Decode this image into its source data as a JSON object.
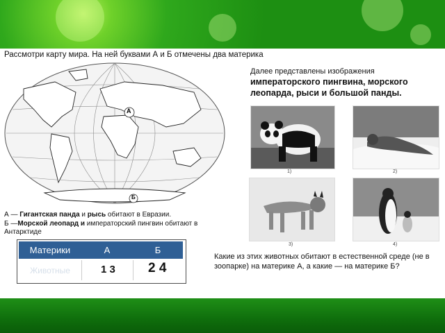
{
  "task": {
    "line1": "Рассмотри карту мира. На ней буквами А и Б отмечены два материка"
  },
  "map": {
    "label_a": "А",
    "label_b": "Б"
  },
  "intro": {
    "lead": "Далее представлены изображения",
    "bold": "императорского пингвина, морского леопарда, рыси и большой панды."
  },
  "photos": [
    {
      "caption": "1)",
      "icon": "panda"
    },
    {
      "caption": "2)",
      "icon": "leopard-seal"
    },
    {
      "caption": "3)",
      "icon": "lynx"
    },
    {
      "caption": "4)",
      "icon": "penguin"
    }
  ],
  "note": {
    "a_prefix": "А — ",
    "a_bold1": "Гигантская панда",
    "a_and": " и ",
    "a_bold2": "рысь",
    "a_rest": " обитают в Евразии.",
    "b_prefix": "Б —",
    "b_bold1": "Морской леопард",
    "b_and": " и ",
    "b_rest": "императорский пингвин обитают в Антарктиде"
  },
  "table": {
    "header_label": "Материки",
    "col_a": "А",
    "col_b": "Б",
    "row_label": "Животные",
    "answer_a": "1 3",
    "answer_b": "2 4"
  },
  "question": {
    "text": "Какие из этих животных обитают в естественной среде (не в зоопарке) на материке А, а какие — на материке Б?"
  },
  "colors": {
    "table_header": "#2f5f95",
    "banner_green": "#2fa81c"
  }
}
